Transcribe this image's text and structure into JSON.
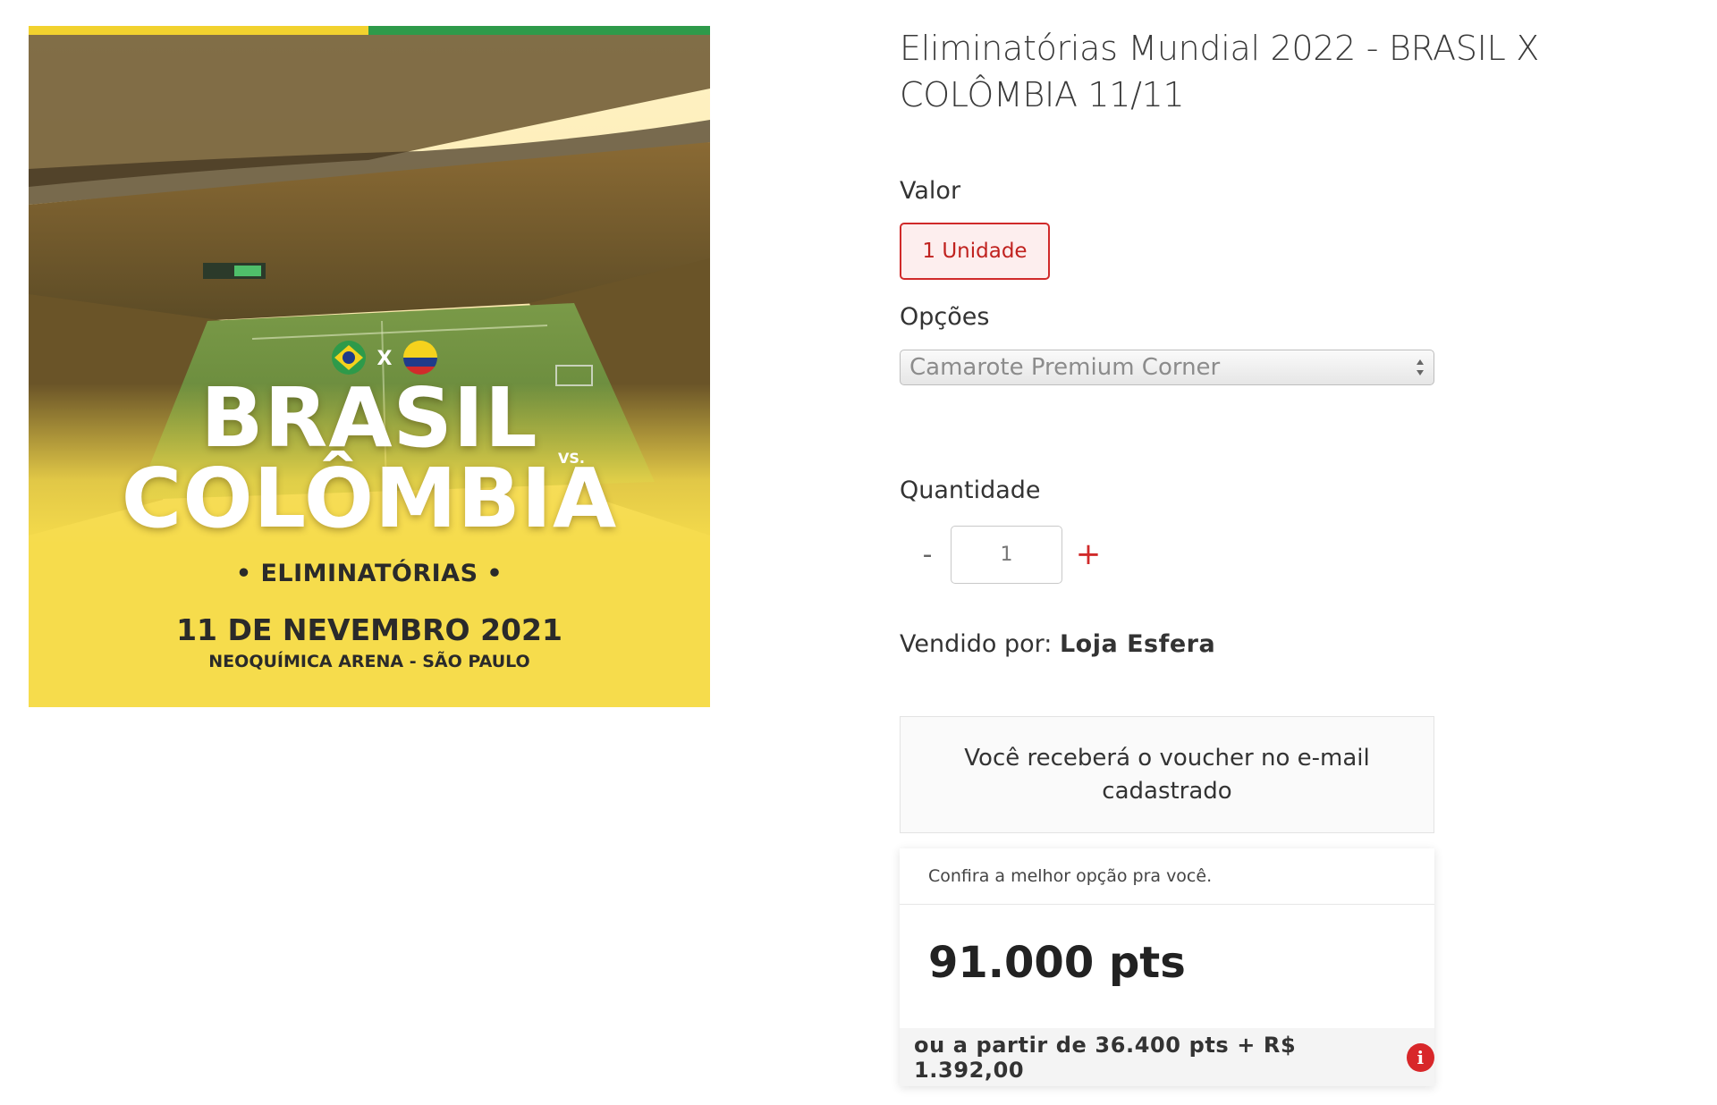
{
  "poster": {
    "title_line1": "BRASIL",
    "versus": "VS.",
    "title_line2": "COLÔMBIA",
    "competition": "• ELIMINATÓRIAS •",
    "date": "11 DE NEVEMBRO 2021",
    "venue": "NEOQUÍMICA ARENA - SÃO PAULO",
    "flags_separator": "X",
    "icons": [
      "brazil-flag",
      "colombia-flag"
    ]
  },
  "product": {
    "title": "Eliminatórias Mundial 2022 - BRASIL X COLÔMBIA 11/11"
  },
  "valor": {
    "label": "Valor",
    "option": "1 Unidade"
  },
  "opcoes": {
    "label": "Opções",
    "selected": "Camarote Premium Corner"
  },
  "quantidade": {
    "label": "Quantidade",
    "minus": "-",
    "value": "1",
    "plus": "+"
  },
  "seller": {
    "prefix": "Vendido por:",
    "name": "Loja Esfera"
  },
  "voucher": {
    "message": "Você receberá o voucher no e-mail cadastrado"
  },
  "price": {
    "header": "Confira a melhor opção pra você.",
    "points": "91.000 pts",
    "alternative": "ou a partir de 36.400 pts + R$ 1.392,00",
    "info_icon": "i"
  },
  "colors": {
    "accent": "#d02a2a",
    "poster_yellow": "#f6dc4c",
    "poster_green": "#2e9a4a"
  }
}
